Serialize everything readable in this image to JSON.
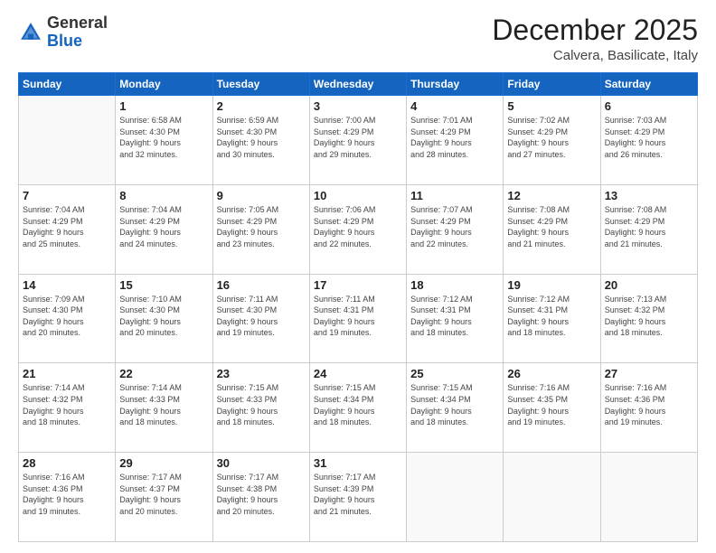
{
  "header": {
    "logo_general": "General",
    "logo_blue": "Blue",
    "month_title": "December 2025",
    "location": "Calvera, Basilicate, Italy"
  },
  "weekdays": [
    "Sunday",
    "Monday",
    "Tuesday",
    "Wednesday",
    "Thursday",
    "Friday",
    "Saturday"
  ],
  "weeks": [
    [
      {
        "day": "",
        "info": ""
      },
      {
        "day": "1",
        "info": "Sunrise: 6:58 AM\nSunset: 4:30 PM\nDaylight: 9 hours\nand 32 minutes."
      },
      {
        "day": "2",
        "info": "Sunrise: 6:59 AM\nSunset: 4:30 PM\nDaylight: 9 hours\nand 30 minutes."
      },
      {
        "day": "3",
        "info": "Sunrise: 7:00 AM\nSunset: 4:29 PM\nDaylight: 9 hours\nand 29 minutes."
      },
      {
        "day": "4",
        "info": "Sunrise: 7:01 AM\nSunset: 4:29 PM\nDaylight: 9 hours\nand 28 minutes."
      },
      {
        "day": "5",
        "info": "Sunrise: 7:02 AM\nSunset: 4:29 PM\nDaylight: 9 hours\nand 27 minutes."
      },
      {
        "day": "6",
        "info": "Sunrise: 7:03 AM\nSunset: 4:29 PM\nDaylight: 9 hours\nand 26 minutes."
      }
    ],
    [
      {
        "day": "7",
        "info": "Sunrise: 7:04 AM\nSunset: 4:29 PM\nDaylight: 9 hours\nand 25 minutes."
      },
      {
        "day": "8",
        "info": "Sunrise: 7:04 AM\nSunset: 4:29 PM\nDaylight: 9 hours\nand 24 minutes."
      },
      {
        "day": "9",
        "info": "Sunrise: 7:05 AM\nSunset: 4:29 PM\nDaylight: 9 hours\nand 23 minutes."
      },
      {
        "day": "10",
        "info": "Sunrise: 7:06 AM\nSunset: 4:29 PM\nDaylight: 9 hours\nand 22 minutes."
      },
      {
        "day": "11",
        "info": "Sunrise: 7:07 AM\nSunset: 4:29 PM\nDaylight: 9 hours\nand 22 minutes."
      },
      {
        "day": "12",
        "info": "Sunrise: 7:08 AM\nSunset: 4:29 PM\nDaylight: 9 hours\nand 21 minutes."
      },
      {
        "day": "13",
        "info": "Sunrise: 7:08 AM\nSunset: 4:29 PM\nDaylight: 9 hours\nand 21 minutes."
      }
    ],
    [
      {
        "day": "14",
        "info": "Sunrise: 7:09 AM\nSunset: 4:30 PM\nDaylight: 9 hours\nand 20 minutes."
      },
      {
        "day": "15",
        "info": "Sunrise: 7:10 AM\nSunset: 4:30 PM\nDaylight: 9 hours\nand 20 minutes."
      },
      {
        "day": "16",
        "info": "Sunrise: 7:11 AM\nSunset: 4:30 PM\nDaylight: 9 hours\nand 19 minutes."
      },
      {
        "day": "17",
        "info": "Sunrise: 7:11 AM\nSunset: 4:31 PM\nDaylight: 9 hours\nand 19 minutes."
      },
      {
        "day": "18",
        "info": "Sunrise: 7:12 AM\nSunset: 4:31 PM\nDaylight: 9 hours\nand 18 minutes."
      },
      {
        "day": "19",
        "info": "Sunrise: 7:12 AM\nSunset: 4:31 PM\nDaylight: 9 hours\nand 18 minutes."
      },
      {
        "day": "20",
        "info": "Sunrise: 7:13 AM\nSunset: 4:32 PM\nDaylight: 9 hours\nand 18 minutes."
      }
    ],
    [
      {
        "day": "21",
        "info": "Sunrise: 7:14 AM\nSunset: 4:32 PM\nDaylight: 9 hours\nand 18 minutes."
      },
      {
        "day": "22",
        "info": "Sunrise: 7:14 AM\nSunset: 4:33 PM\nDaylight: 9 hours\nand 18 minutes."
      },
      {
        "day": "23",
        "info": "Sunrise: 7:15 AM\nSunset: 4:33 PM\nDaylight: 9 hours\nand 18 minutes."
      },
      {
        "day": "24",
        "info": "Sunrise: 7:15 AM\nSunset: 4:34 PM\nDaylight: 9 hours\nand 18 minutes."
      },
      {
        "day": "25",
        "info": "Sunrise: 7:15 AM\nSunset: 4:34 PM\nDaylight: 9 hours\nand 18 minutes."
      },
      {
        "day": "26",
        "info": "Sunrise: 7:16 AM\nSunset: 4:35 PM\nDaylight: 9 hours\nand 19 minutes."
      },
      {
        "day": "27",
        "info": "Sunrise: 7:16 AM\nSunset: 4:36 PM\nDaylight: 9 hours\nand 19 minutes."
      }
    ],
    [
      {
        "day": "28",
        "info": "Sunrise: 7:16 AM\nSunset: 4:36 PM\nDaylight: 9 hours\nand 19 minutes."
      },
      {
        "day": "29",
        "info": "Sunrise: 7:17 AM\nSunset: 4:37 PM\nDaylight: 9 hours\nand 20 minutes."
      },
      {
        "day": "30",
        "info": "Sunrise: 7:17 AM\nSunset: 4:38 PM\nDaylight: 9 hours\nand 20 minutes."
      },
      {
        "day": "31",
        "info": "Sunrise: 7:17 AM\nSunset: 4:39 PM\nDaylight: 9 hours\nand 21 minutes."
      },
      {
        "day": "",
        "info": ""
      },
      {
        "day": "",
        "info": ""
      },
      {
        "day": "",
        "info": ""
      }
    ]
  ]
}
